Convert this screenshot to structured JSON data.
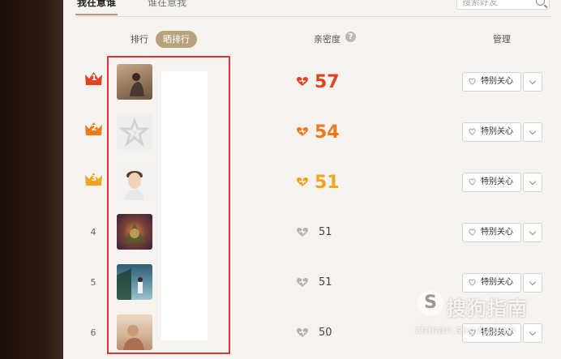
{
  "tabs": [
    {
      "label": "我在意谁",
      "active": true
    },
    {
      "label": "谁在意我",
      "active": false
    }
  ],
  "search": {
    "placeholder": "搜索好友"
  },
  "header": {
    "rank": "排行",
    "share_rank": "晒排行",
    "intimacy": "亲密度",
    "help": "?",
    "manage": "管理"
  },
  "rows": [
    {
      "rank": "1",
      "crown": true,
      "crown_color": "#e2421f",
      "score": "57",
      "score_color": "#e2421f",
      "care": "特别关心"
    },
    {
      "rank": "2",
      "crown": true,
      "crown_color": "#f07a1a",
      "score": "54",
      "score_color": "#f07a1a",
      "care": "特别关心"
    },
    {
      "rank": "3",
      "crown": true,
      "crown_color": "#f2a321",
      "score": "51",
      "score_color": "#f2a321",
      "care": "特别关心"
    },
    {
      "rank": "4",
      "crown": false,
      "score": "51",
      "score_color": "#444444",
      "care": "特别关心"
    },
    {
      "rank": "5",
      "crown": false,
      "score": "51",
      "score_color": "#444444",
      "care": "特别关心"
    },
    {
      "rank": "6",
      "crown": false,
      "score": "50",
      "score_color": "#444444",
      "care": "特别关心"
    }
  ],
  "watermark": {
    "logo": "S",
    "brand": "搜狗指南",
    "url": "zhinan.sogou.com"
  },
  "colors": {
    "highlight": "#d9363a",
    "accent": "#b7a27c"
  }
}
